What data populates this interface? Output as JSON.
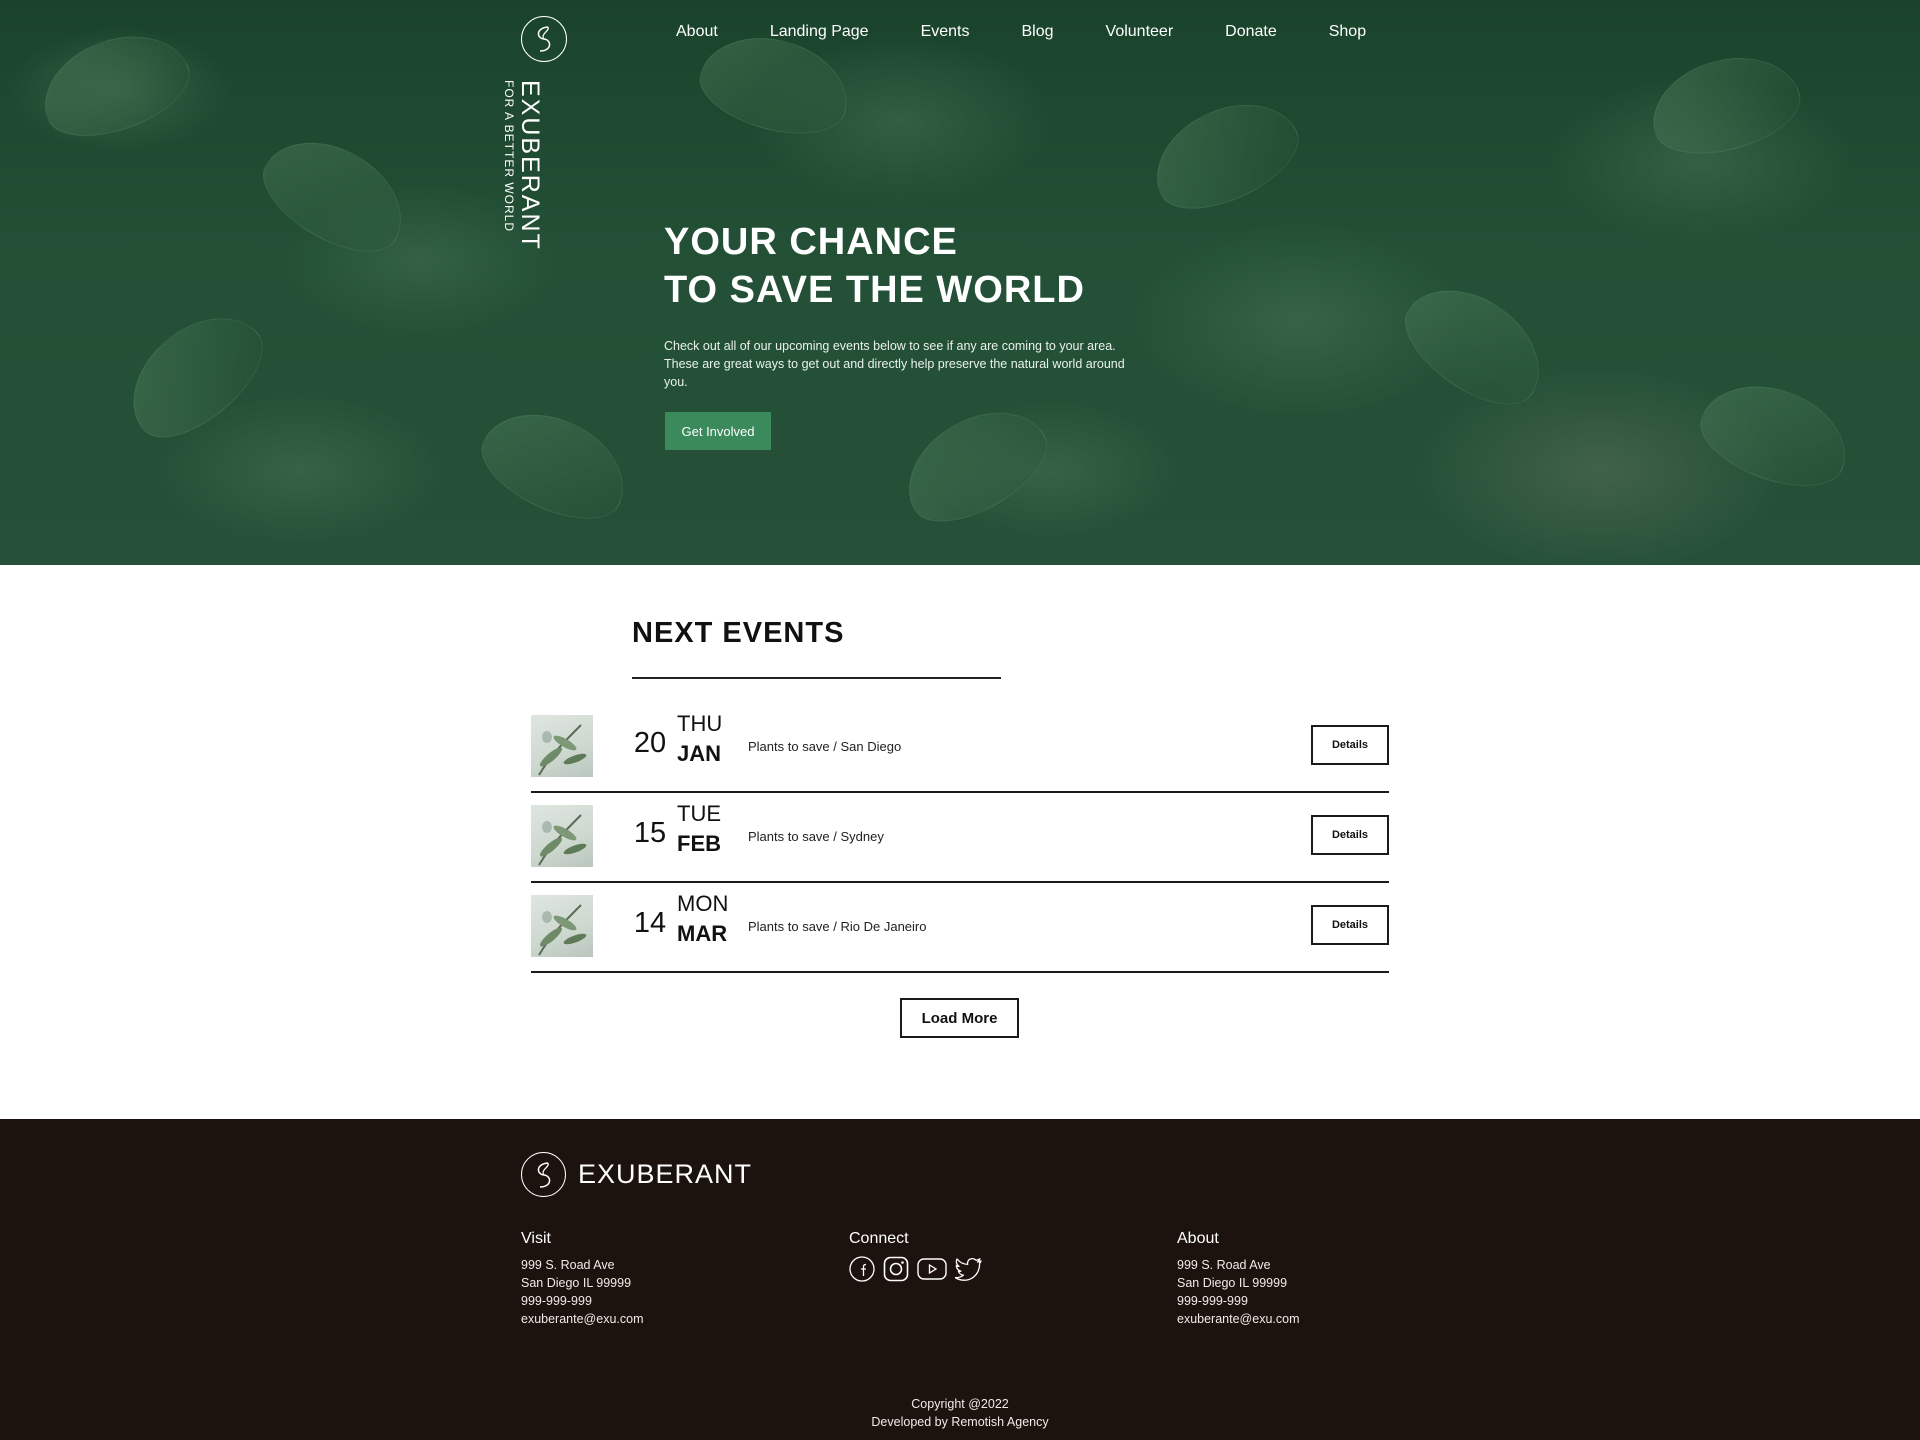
{
  "brand": {
    "name": "EXUBERANT",
    "tagline": "FOR A BETTER WORLD"
  },
  "nav": {
    "items": [
      "About",
      "Landing Page",
      "Events",
      "Blog",
      "Volunteer",
      "Donate",
      "Shop"
    ]
  },
  "hero": {
    "title_line1": "YOUR CHANCE",
    "title_line2": "TO SAVE THE WORLD",
    "text": "Check out all of our upcoming events below to see if any are coming to your area. These are great ways to get out and directly help preserve the natural world around you.",
    "cta_label": "Get Involved"
  },
  "events": {
    "heading": "NEXT EVENTS",
    "items": [
      {
        "day": "20",
        "weekday": "THU",
        "month": "JAN",
        "title": "Plants to save / San Diego",
        "button": "Details"
      },
      {
        "day": "15",
        "weekday": "TUE",
        "month": "FEB",
        "title": "Plants to save / Sydney",
        "button": "Details"
      },
      {
        "day": "14",
        "weekday": "MON",
        "month": "MAR",
        "title": "Plants to save / Rio De Janeiro",
        "button": "Details"
      }
    ],
    "load_more": "Load More"
  },
  "footer": {
    "brand": "EXUBERANT",
    "visit": {
      "heading": "Visit",
      "lines": [
        "999 S. Road Ave",
        "San Diego IL 99999",
        "999-999-999",
        "exuberante@exu.com"
      ]
    },
    "connect": {
      "heading": "Connect",
      "icons": [
        "facebook-icon",
        "instagram-icon",
        "youtube-icon",
        "twitter-icon"
      ]
    },
    "about": {
      "heading": "About",
      "lines": [
        "999 S. Road Ave",
        "San Diego IL 99999",
        "999-999-999",
        "exuberante@exu.com"
      ]
    },
    "copyright": "Copyright @2022",
    "developer": "Developed by Remotish Agency"
  },
  "colors": {
    "accent": "#3a8a5c",
    "footer_bg": "#1c120e",
    "hero_bg": "#2b5e40"
  }
}
